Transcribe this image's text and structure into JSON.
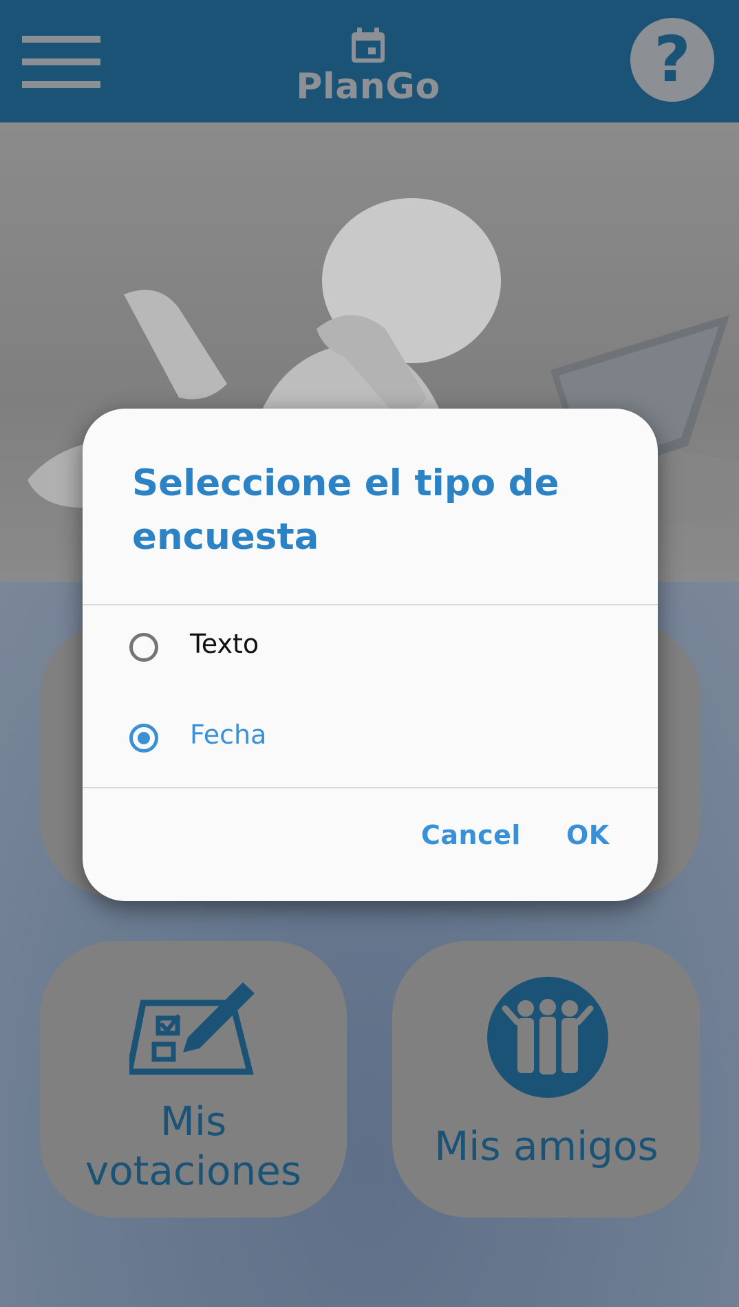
{
  "app_bar": {
    "title": "PlanGo",
    "menu_icon": "hamburger-menu-icon",
    "logo_icon": "calendar-icon",
    "help_icon": "question-mark-icon",
    "help_label": "?",
    "background_color": "#1b5377"
  },
  "hero": {
    "image": "person-lying-with-laptop-illustration"
  },
  "tiles": {
    "votes": {
      "label_line1": "Mis",
      "label_line2": "votaciones",
      "icon": "ballot-checklist-pencil-icon"
    },
    "friends": {
      "label": "Mis amigos",
      "icon": "group-of-friends-icon"
    }
  },
  "dialog": {
    "title": "Seleccione el tipo de encuesta",
    "options": [
      {
        "label": "Texto",
        "selected": false
      },
      {
        "label": "Fecha",
        "selected": true
      }
    ],
    "cancel_label": "Cancel",
    "ok_label": "OK",
    "accent_color": "#3a90d6"
  }
}
